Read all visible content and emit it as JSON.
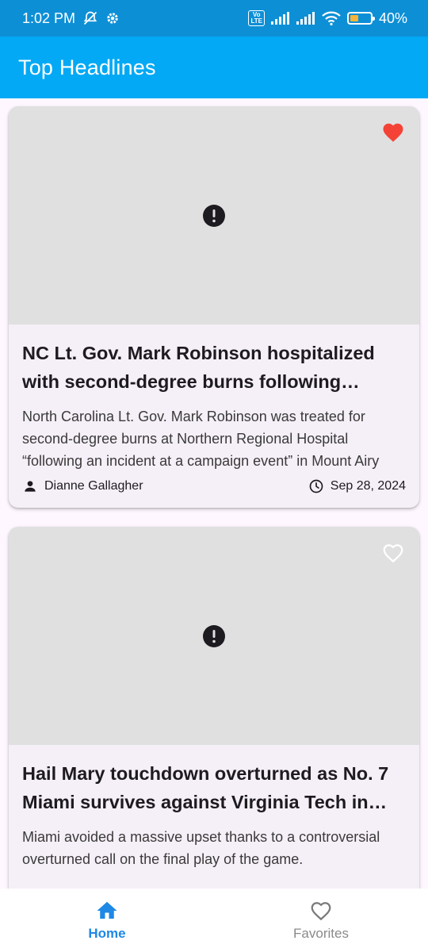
{
  "status_bar": {
    "time": "1:02 PM",
    "volte_label": "Vo\nLTE",
    "battery_percent": "40%",
    "battery_level": 0.4,
    "icons": [
      "mute-icon",
      "settings-icon",
      "volte-icon",
      "signal-icon",
      "signal-icon",
      "wifi-icon",
      "battery-icon"
    ]
  },
  "app_bar": {
    "title": "Top Headlines",
    "color": "#03a9f4"
  },
  "articles": [
    {
      "title": "NC Lt. Gov. Mark Robinson hospitalized with second-degree burns following incident at a campaign event",
      "description": "North Carolina Lt. Gov. Mark Robinson was treated for second-degree burns at Northern Regional Hospital “following an incident at a campaign event” in Mount Airy",
      "author": "Dianne Gallagher",
      "date": "Sep 28, 2024",
      "favorited": true,
      "image_state": "error-icon"
    },
    {
      "title": "Hail Mary touchdown overturned as No. 7 Miami survives against Virginia Tech in thriller",
      "description": "Miami avoided a massive upset thanks to a controversial overturned call on the final play of the game.",
      "author": "",
      "date": "",
      "favorited": false,
      "image_state": "error-icon"
    }
  ],
  "bottom_nav": {
    "items": [
      {
        "label": "Home",
        "icon": "home-icon",
        "active": true
      },
      {
        "label": "Favorites",
        "icon": "heart-outline-icon",
        "active": false
      }
    ],
    "active_color": "#1e88e5",
    "inactive_color": "#8a8a8a"
  },
  "colors": {
    "favorite_active": "#f44336",
    "favorite_inactive": "#ffffff",
    "status_bar": "#0d8fd6"
  }
}
